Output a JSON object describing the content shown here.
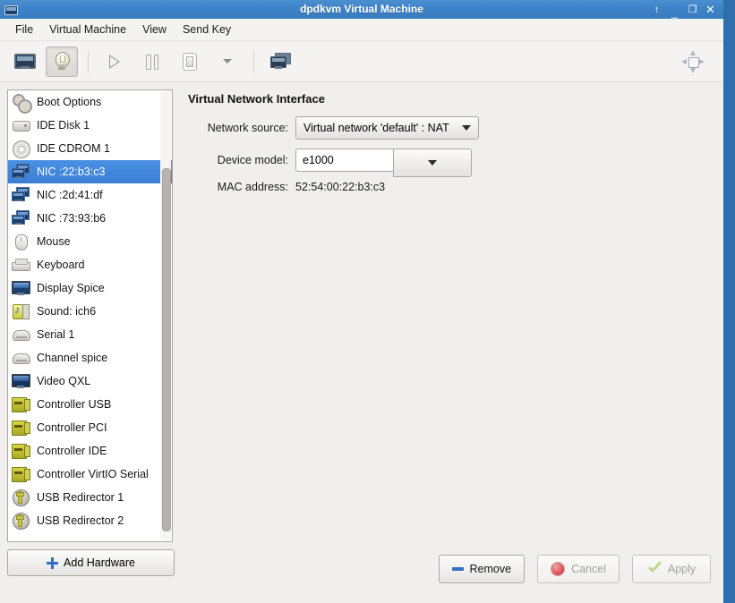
{
  "window": {
    "title": "dpdkvm Virtual Machine",
    "icon": "vm-icon",
    "controls": [
      {
        "name": "shade-button",
        "glyph": "↑"
      },
      {
        "name": "minimize-button",
        "glyph": "_"
      },
      {
        "name": "maximize-button",
        "glyph": "❐"
      },
      {
        "name": "close-button",
        "glyph": "✕"
      }
    ]
  },
  "menubar": {
    "items": [
      {
        "label": "File",
        "name": "menu-file"
      },
      {
        "label": "Virtual Machine",
        "name": "menu-virtual-machine"
      },
      {
        "label": "View",
        "name": "menu-view"
      },
      {
        "label": "Send Key",
        "name": "menu-send-key"
      }
    ]
  },
  "toolbar": {
    "buttons": [
      {
        "name": "show-console-button",
        "icon": "monitor-icon",
        "active": false
      },
      {
        "name": "show-details-button",
        "icon": "lightbulb-icon",
        "active": true
      },
      {
        "name": "run-button",
        "icon": "play-icon",
        "active": false
      },
      {
        "name": "pause-button",
        "icon": "pause-icon",
        "active": false
      },
      {
        "name": "shutdown-button",
        "icon": "shutdown-icon",
        "active": false
      },
      {
        "name": "shutdown-menu-button",
        "icon": "chevron-down-icon",
        "active": false
      },
      {
        "name": "snapshots-button",
        "icon": "snapshots-icon",
        "active": false
      }
    ],
    "fullscreen": {
      "name": "fullscreen-button",
      "icon": "fullscreen-icon"
    }
  },
  "sidebar": {
    "items": [
      {
        "label": "Boot Options",
        "icon": "boot-options-icon",
        "icon_class": "i-boot",
        "selected": false
      },
      {
        "label": "IDE Disk 1",
        "icon": "disk-icon",
        "icon_class": "i-disk",
        "selected": false
      },
      {
        "label": "IDE CDROM 1",
        "icon": "cdrom-icon",
        "icon_class": "i-cd",
        "selected": false
      },
      {
        "label": "NIC :22:b3:c3",
        "icon": "network-icon",
        "icon_class": "i-nic",
        "selected": true
      },
      {
        "label": "NIC :2d:41:df",
        "icon": "network-icon",
        "icon_class": "i-nic",
        "selected": false
      },
      {
        "label": "NIC :73:93:b6",
        "icon": "network-icon",
        "icon_class": "i-nic",
        "selected": false
      },
      {
        "label": "Mouse",
        "icon": "mouse-icon",
        "icon_class": "i-mouse",
        "selected": false
      },
      {
        "label": "Keyboard",
        "icon": "keyboard-icon",
        "icon_class": "i-kb",
        "selected": false
      },
      {
        "label": "Display Spice",
        "icon": "display-icon",
        "icon_class": "i-disp",
        "selected": false
      },
      {
        "label": "Sound: ich6",
        "icon": "sound-icon",
        "icon_class": "i-snd",
        "selected": false
      },
      {
        "label": "Serial 1",
        "icon": "serial-icon",
        "icon_class": "i-ser",
        "selected": false
      },
      {
        "label": "Channel spice",
        "icon": "channel-icon",
        "icon_class": "i-ser",
        "selected": false
      },
      {
        "label": "Video QXL",
        "icon": "video-icon",
        "icon_class": "i-vid",
        "selected": false
      },
      {
        "label": "Controller USB",
        "icon": "controller-icon",
        "icon_class": "i-ctrl",
        "selected": false
      },
      {
        "label": "Controller PCI",
        "icon": "controller-icon",
        "icon_class": "i-ctrl",
        "selected": false
      },
      {
        "label": "Controller IDE",
        "icon": "controller-icon",
        "icon_class": "i-ctrl",
        "selected": false
      },
      {
        "label": "Controller VirtIO Serial",
        "icon": "controller-icon",
        "icon_class": "i-ctrl",
        "selected": false
      },
      {
        "label": "USB Redirector 1",
        "icon": "usb-icon",
        "icon_class": "i-usb",
        "selected": false
      },
      {
        "label": "USB Redirector 2",
        "icon": "usb-icon",
        "icon_class": "i-usb",
        "selected": false
      }
    ],
    "add_hardware_label": "Add Hardware"
  },
  "details": {
    "title": "Virtual Network Interface",
    "fields": {
      "network_source_label": "Network source:",
      "network_source_value": "Virtual network 'default' : NAT",
      "device_model_label": "Device model:",
      "device_model_value": "e1000",
      "mac_address_label": "MAC address:",
      "mac_address_value": "52:54:00:22:b3:c3"
    }
  },
  "actions": {
    "remove_label": "Remove",
    "cancel_label": "Cancel",
    "apply_label": "Apply"
  },
  "colors": {
    "titlebar": "#3d82c6",
    "selection": "#3a7fd5",
    "accent_blue": "#2f6fc4",
    "panel_bg": "#f0efee"
  }
}
